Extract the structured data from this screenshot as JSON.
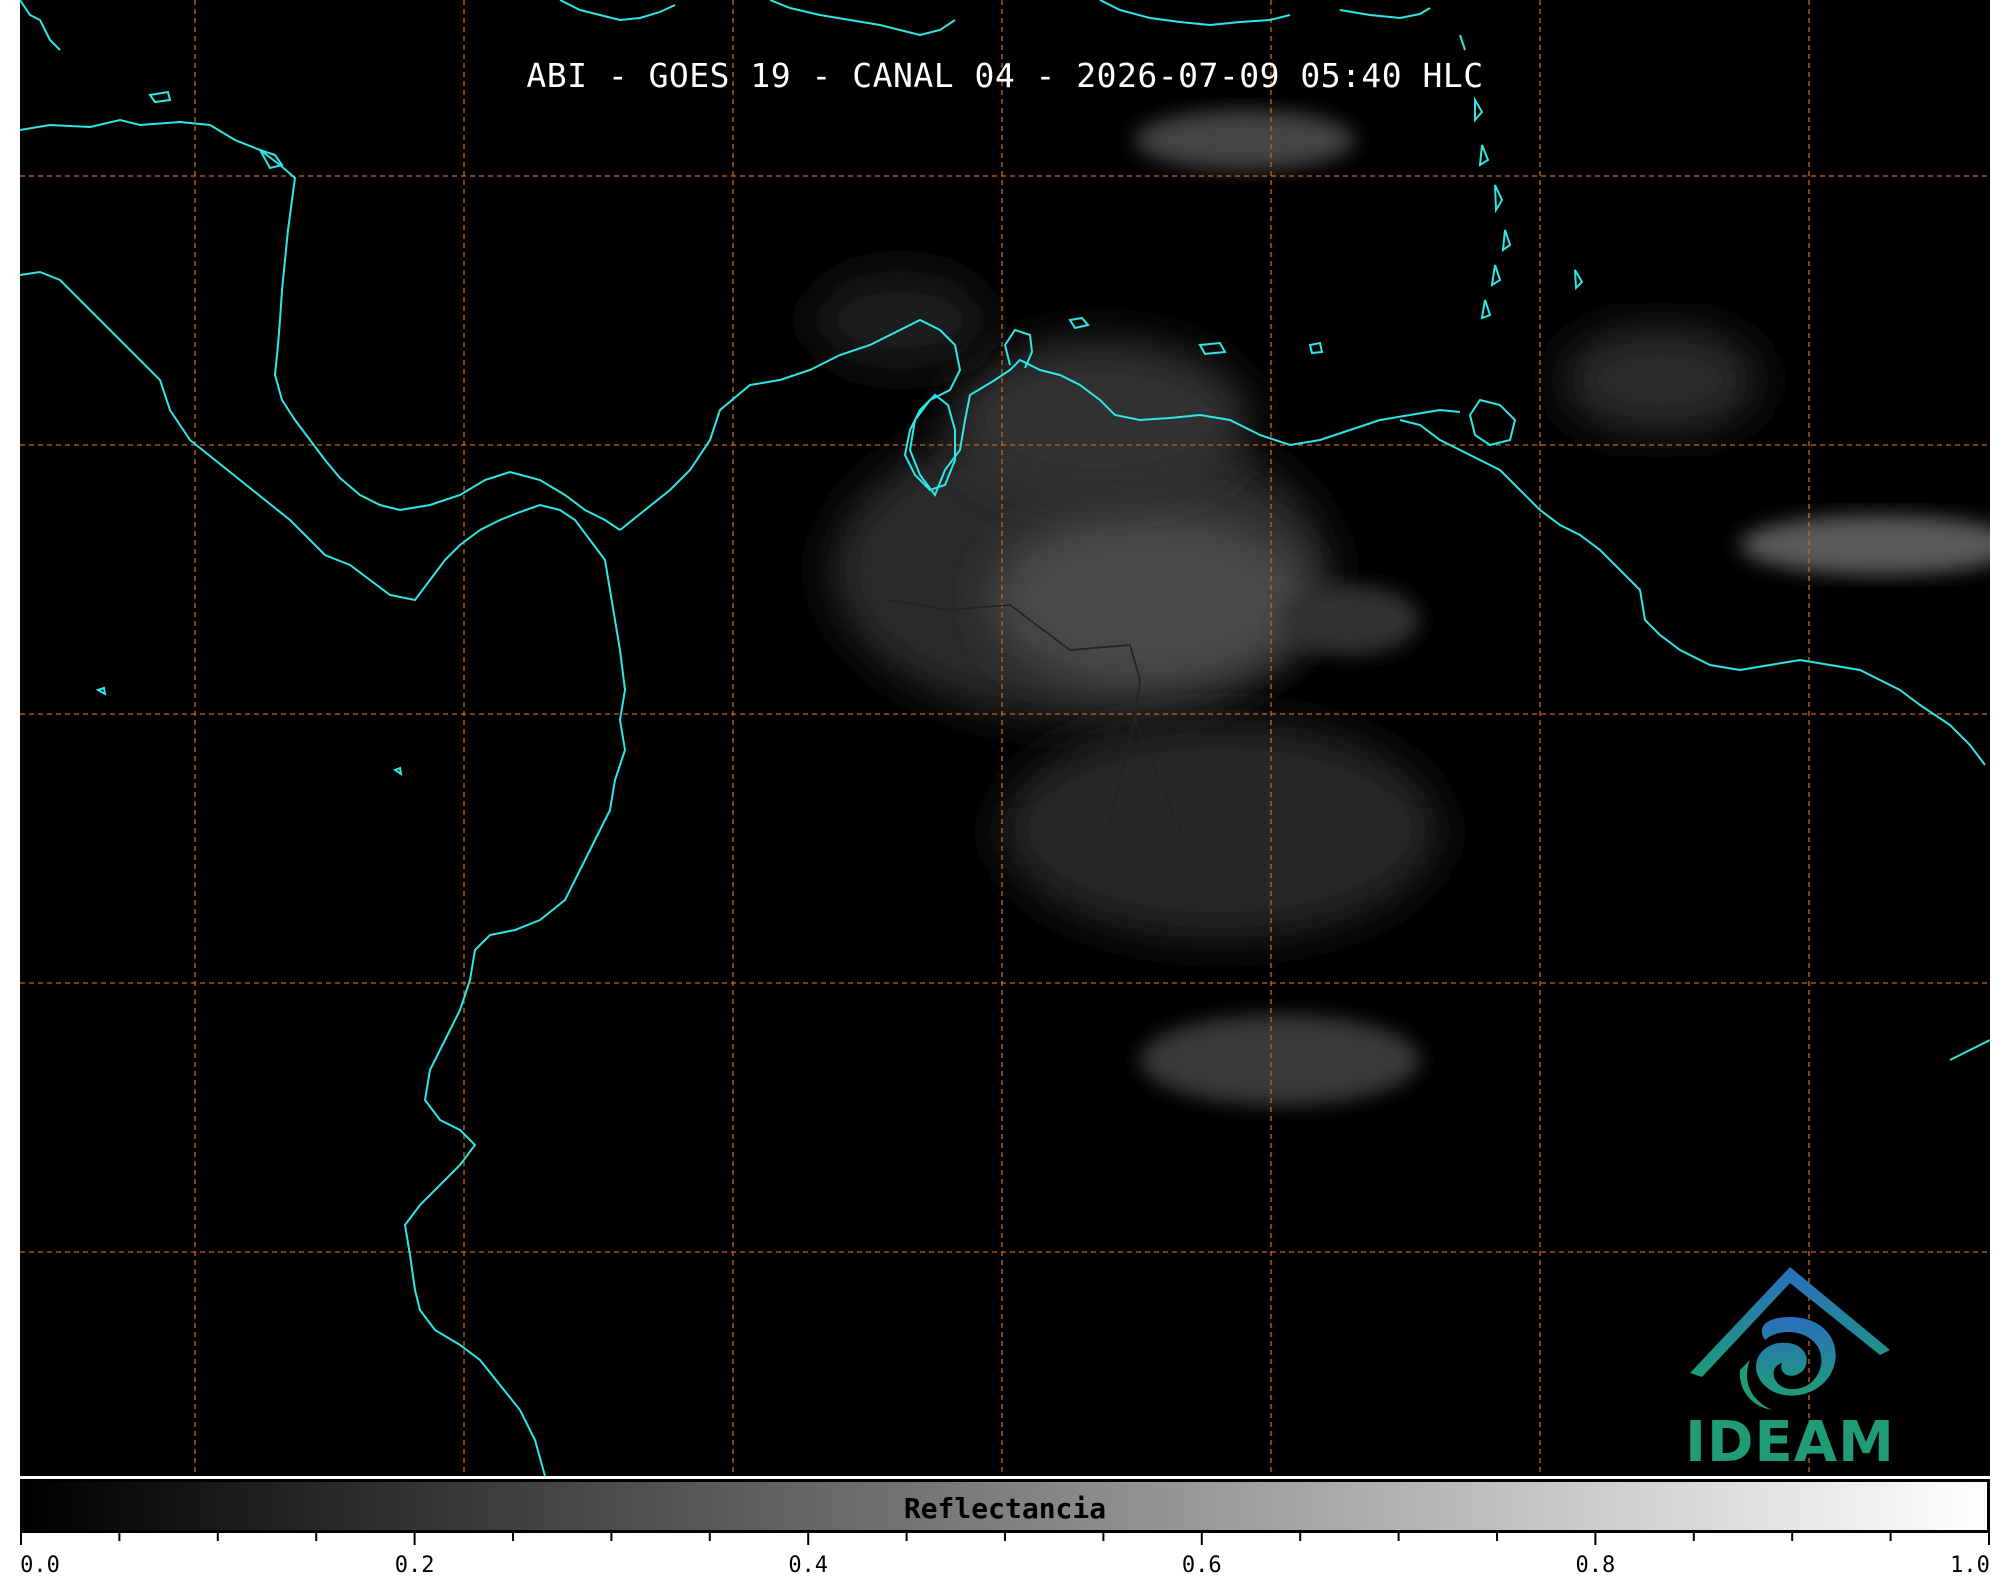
{
  "title": "ABI - GOES 19 - CANAL 04 - 2026-07-09 05:40 HLC",
  "colors": {
    "background": "#000000",
    "coastline": "#2ee6e6",
    "graticule": "#c8651b",
    "borders": "#222222",
    "logo_blue": "#2a6fc0",
    "logo_teal": "#1f9b78"
  },
  "logo": {
    "name": "IDEAM",
    "icon": "ideam-logo-icon"
  },
  "colorbar": {
    "label": "Reflectancia",
    "range": [
      0.0,
      1.0
    ],
    "ticks": [
      "0.0",
      "0.2",
      "0.4",
      "0.6",
      "0.8",
      "1.0"
    ],
    "colormap": [
      "#000000",
      "#ffffff"
    ]
  },
  "graticule": {
    "visible": true,
    "style": "dashed"
  }
}
